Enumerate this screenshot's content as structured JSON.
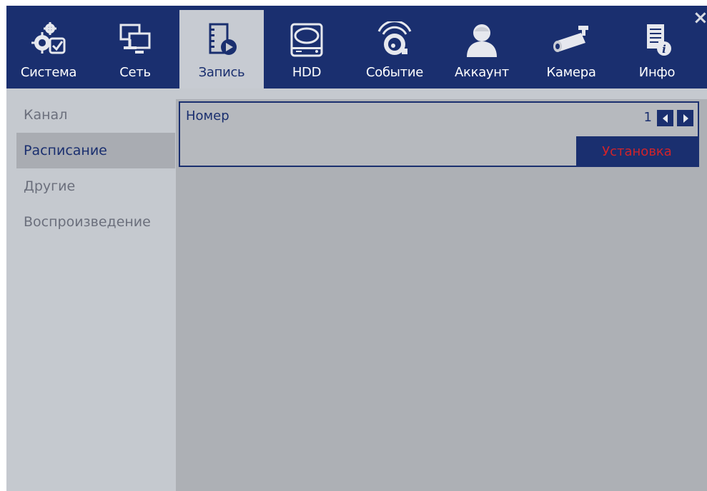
{
  "tabs": [
    {
      "label": "Система",
      "icon": "system-gear-check-icon"
    },
    {
      "label": "Сеть",
      "icon": "network-monitors-icon"
    },
    {
      "label": "Запись",
      "icon": "record-film-play-icon"
    },
    {
      "label": "HDD",
      "icon": "hdd-disk-icon"
    },
    {
      "label": "Событие",
      "icon": "event-alarm-icon"
    },
    {
      "label": "Аккаунт",
      "icon": "account-user-icon"
    },
    {
      "label": "Камера",
      "icon": "camera-bullet-icon"
    },
    {
      "label": "Инфо",
      "icon": "info-document-icon"
    }
  ],
  "active_tab": "Запись",
  "close_label": "×",
  "sidebar": {
    "items": [
      {
        "label": "Канал"
      },
      {
        "label": "Расписание"
      },
      {
        "label": "Другие"
      },
      {
        "label": "Воспроизведение"
      }
    ],
    "active": "Расписание"
  },
  "schedule": {
    "number_label": "Номер",
    "number_value": "1",
    "setup_button": "Установка"
  },
  "colors": {
    "navy": "#1a2f6f",
    "panel": "#c5c9cf",
    "main": "#adb0b5",
    "accent_red": "#d2232a"
  }
}
